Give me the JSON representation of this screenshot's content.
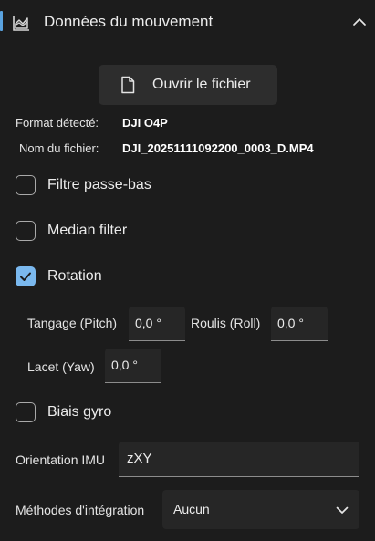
{
  "section": {
    "title": "Données du mouvement",
    "accent_color": "#5aa3e0"
  },
  "open_button": {
    "label": "Ouvrir le fichier",
    "icon": "file-icon"
  },
  "info": {
    "format_label": "Format détecté:",
    "format_value": "DJI O4P",
    "filename_label": "Nom du fichier:",
    "filename_value": "DJI_20251111092200_0003_D.MP4"
  },
  "options": {
    "lowpass": {
      "label": "Filtre passe-bas",
      "checked": false
    },
    "median": {
      "label": "Median filter",
      "checked": false
    },
    "rotation": {
      "label": "Rotation",
      "checked": true
    },
    "gyro_bias": {
      "label": "Biais gyro",
      "checked": false
    }
  },
  "rotation_fields": {
    "pitch_label": "Tangage (Pitch)",
    "pitch_value": "0,0 °",
    "roll_label": "Roulis (Roll)",
    "roll_value": "0,0 °",
    "yaw_label": "Lacet (Yaw)",
    "yaw_value": "0,0 °"
  },
  "imu": {
    "label": "Orientation IMU",
    "value": "zXY"
  },
  "integration": {
    "label": "Méthodes d'intégration",
    "selected": "Aucun"
  }
}
